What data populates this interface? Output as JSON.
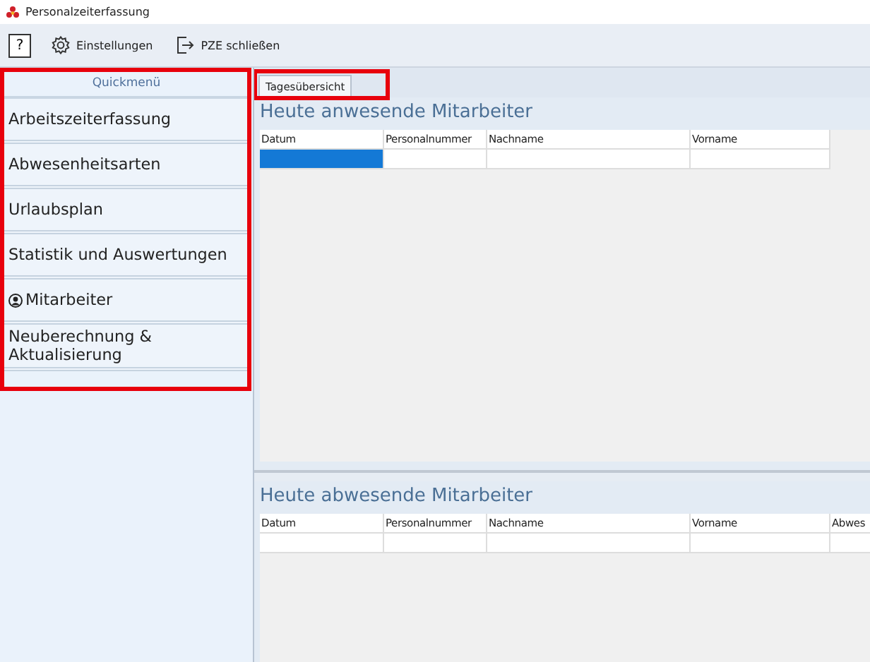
{
  "window": {
    "title": "Personalzeiterfassung"
  },
  "toolbar": [
    {
      "kind": "help",
      "label": "?"
    },
    {
      "kind": "settings",
      "label": "Einstellungen"
    },
    {
      "kind": "exit",
      "label": "PZE schließen"
    }
  ],
  "sidebar": {
    "title": "Quickmenü",
    "highlighted": true,
    "items": [
      {
        "label": "Arbeitszeiterfassung",
        "kind": "text"
      },
      {
        "label": "Abwesenheitsarten",
        "kind": "text"
      },
      {
        "label": "Urlaubsplan",
        "kind": "text"
      },
      {
        "label": "Statistik und Auswertungen",
        "kind": "text"
      },
      {
        "label": "Mitarbeiter",
        "kind": "person"
      },
      {
        "label": "Neuberechnung & Aktualisierung",
        "kind": "text"
      }
    ]
  },
  "tabs": [
    {
      "label": "Tagesübersicht",
      "selected": true,
      "highlighted": true
    }
  ],
  "sections": [
    {
      "title": "Heute anwesende Mitarbeiter",
      "columns": [
        "Datum",
        "Personalnummer",
        "Nachname",
        "Vorname"
      ],
      "rows": [
        {
          "cells": [
            {
              "selected": true
            },
            {
              "selected": false
            },
            {
              "selected": false
            },
            {
              "selected": false
            }
          ]
        }
      ]
    },
    {
      "title": "Heute abwesende Mitarbeiter",
      "columns": [
        "Datum",
        "Personalnummer",
        "Nachname",
        "Vorname",
        "Abwes"
      ],
      "rows": [
        {
          "cells": [
            {
              "selected": false
            },
            {
              "selected": false
            },
            {
              "selected": false
            },
            {
              "selected": false
            },
            {
              "selected": false
            }
          ]
        }
      ]
    }
  ]
}
